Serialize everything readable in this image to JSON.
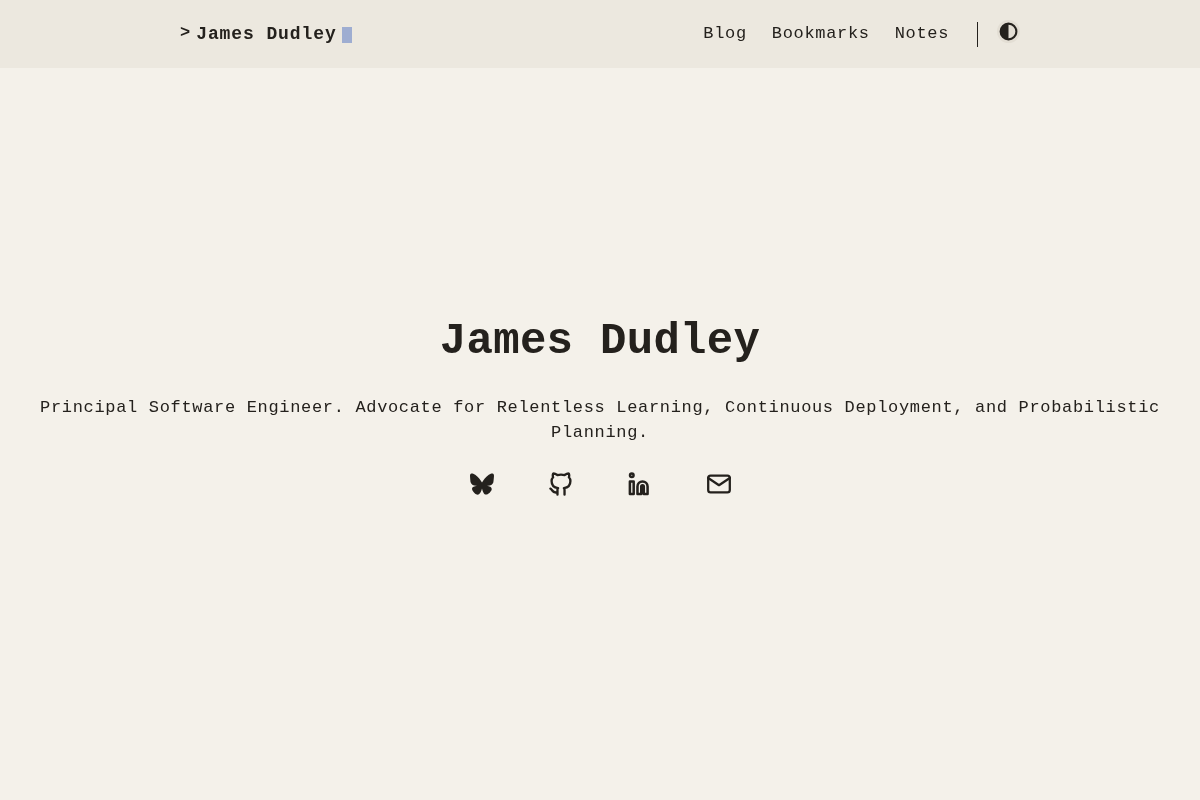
{
  "header": {
    "brand": {
      "prompt": ">",
      "name": "James Dudley"
    },
    "nav": [
      {
        "label": "Blog"
      },
      {
        "label": "Bookmarks"
      },
      {
        "label": "Notes"
      }
    ]
  },
  "hero": {
    "title": "James Dudley",
    "tagline": "Principal Software Engineer. Advocate for Relentless Learning, Continuous Deployment, and Probabilistic Planning."
  }
}
